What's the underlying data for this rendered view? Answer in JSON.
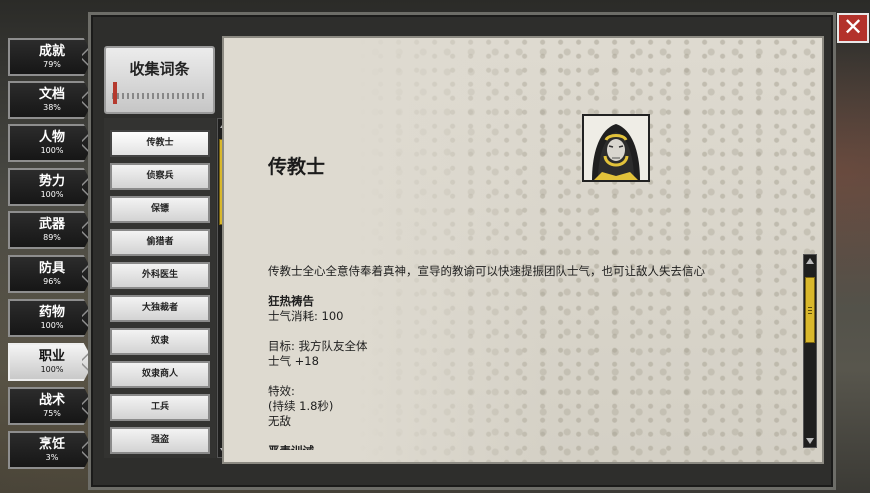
{
  "categories": [
    {
      "name": "成就",
      "pct": "79%"
    },
    {
      "name": "文档",
      "pct": "38%"
    },
    {
      "name": "人物",
      "pct": "100%"
    },
    {
      "name": "势力",
      "pct": "100%"
    },
    {
      "name": "武器",
      "pct": "89%"
    },
    {
      "name": "防具",
      "pct": "96%"
    },
    {
      "name": "药物",
      "pct": "100%"
    },
    {
      "name": "职业",
      "pct": "100%"
    },
    {
      "name": "战术",
      "pct": "75%"
    },
    {
      "name": "烹饪",
      "pct": "3%"
    }
  ],
  "active_category": "职业",
  "collect_header": "收集词条",
  "close_label": "✕",
  "list": [
    {
      "label": "传教士"
    },
    {
      "label": "侦察兵"
    },
    {
      "label": "保镖"
    },
    {
      "label": "偷猎者"
    },
    {
      "label": "外科医生"
    },
    {
      "label": "大独裁者"
    },
    {
      "label": "奴隶"
    },
    {
      "label": "奴隶商人"
    },
    {
      "label": "工兵"
    },
    {
      "label": "强盗"
    }
  ],
  "selected_item": "传教士",
  "entry": {
    "title": "传教士",
    "description": "传教士全心全意侍奉着真神，宣导的教谕可以快速提振团队士气，也可让敌人失去信心",
    "skill_name": "狂热祷告",
    "cost": "士气消耗: 100",
    "target": "目标: 我方队友全体",
    "effect": "士气 +18",
    "special_label": "特效:",
    "duration": "(持续 1.8秒)",
    "special_value": "无敌",
    "next_skill_partial": "恶毒训诫"
  },
  "colors": {
    "accent_yellow": "#d9b82c",
    "close_red": "#b3322b",
    "parchment": "#dedad0"
  }
}
